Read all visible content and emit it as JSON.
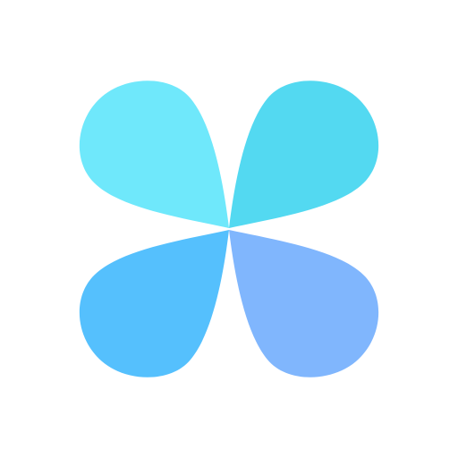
{
  "icon": {
    "name": "four-petal-clover-logo",
    "colors": {
      "background": "#ffffff",
      "petal_top_left": "#6fe8fb",
      "petal_top_right": "#53d9f1",
      "petal_bottom_left": "#55c0fd",
      "petal_bottom_right": "#80b6fd"
    }
  }
}
